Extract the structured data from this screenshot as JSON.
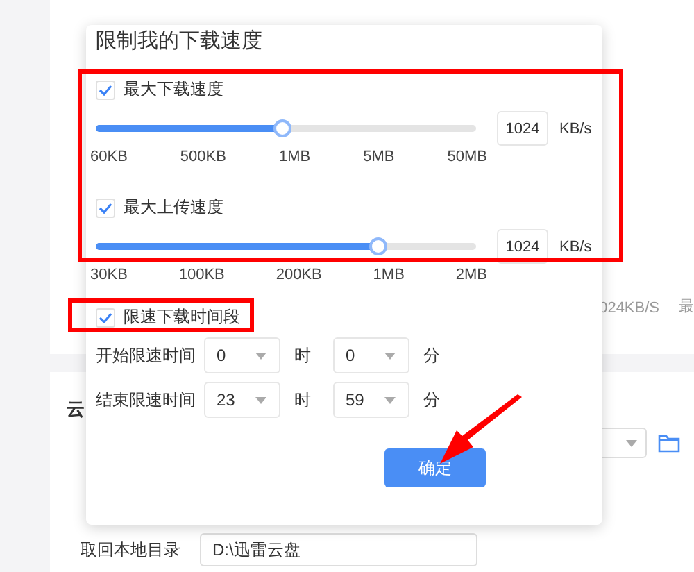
{
  "background": {
    "speed_note": "024KB/S",
    "speed_note_2": "最",
    "section_title": "云",
    "path_label": "取回本地目录",
    "path_value": "D:\\迅雷云盘"
  },
  "dialog": {
    "title": "限制我的下载速度",
    "limits": [
      {
        "label": "最大下载速度",
        "checked": true,
        "level": 0.49,
        "value": "1024",
        "unit": "KB/s",
        "ticks": [
          "60KB",
          "500KB",
          "1MB",
          "5MB",
          "50MB"
        ]
      },
      {
        "label": "最大上传速度",
        "checked": true,
        "level": 0.74,
        "value": "1024",
        "unit": "KB/s",
        "ticks": [
          "30KB",
          "100KB",
          "200KB",
          "1MB",
          "2MB"
        ]
      }
    ],
    "schedule": {
      "label": "限速下载时间段",
      "checked": true,
      "rows": [
        {
          "label": "开始限速时间",
          "hour": "0",
          "hour_unit": "时",
          "minute": "0",
          "minute_unit": "分"
        },
        {
          "label": "结束限速时间",
          "hour": "23",
          "hour_unit": "时",
          "minute": "59",
          "minute_unit": "分"
        }
      ]
    },
    "confirm_button": "确定"
  }
}
